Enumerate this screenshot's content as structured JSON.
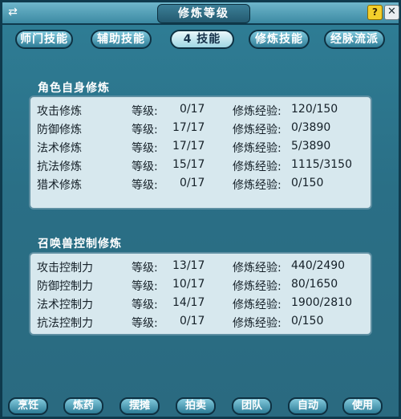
{
  "window": {
    "title": "修炼等级",
    "left_icon": "⇄",
    "help_label": "?",
    "close_label": "✕"
  },
  "tabs": [
    {
      "label": "师门技能",
      "active": false
    },
    {
      "label": "辅助技能",
      "active": false
    },
    {
      "label": "4 技能",
      "active": true
    },
    {
      "label": "修炼技能",
      "active": false
    },
    {
      "label": "经脉流派",
      "active": false
    }
  ],
  "self_section": {
    "title": "角色自身修炼",
    "level_label": "等级:",
    "exp_label": "修炼经验:",
    "rows": [
      {
        "name": "攻击修炼",
        "level": "0/17",
        "exp": "120/150"
      },
      {
        "name": "防御修炼",
        "level": "17/17",
        "exp": "0/3890"
      },
      {
        "name": "法术修炼",
        "level": "17/17",
        "exp": "5/3890"
      },
      {
        "name": "抗法修炼",
        "level": "15/17",
        "exp": "1115/3150"
      },
      {
        "name": "猎术修炼",
        "level": "0/17",
        "exp": "0/150"
      }
    ]
  },
  "pet_section": {
    "title": "召唤兽控制修炼",
    "level_label": "等级:",
    "exp_label": "修炼经验:",
    "rows": [
      {
        "name": "攻击控制力",
        "level": "13/17",
        "exp": "440/2490"
      },
      {
        "name": "防御控制力",
        "level": "10/17",
        "exp": "80/1650"
      },
      {
        "name": "法术控制力",
        "level": "14/17",
        "exp": "1900/2810"
      },
      {
        "name": "抗法控制力",
        "level": "0/17",
        "exp": "0/150"
      }
    ]
  },
  "bottom_buttons": [
    "烹饪",
    "炼药",
    "摆摊",
    "拍卖",
    "团队",
    "自动",
    "使用"
  ]
}
